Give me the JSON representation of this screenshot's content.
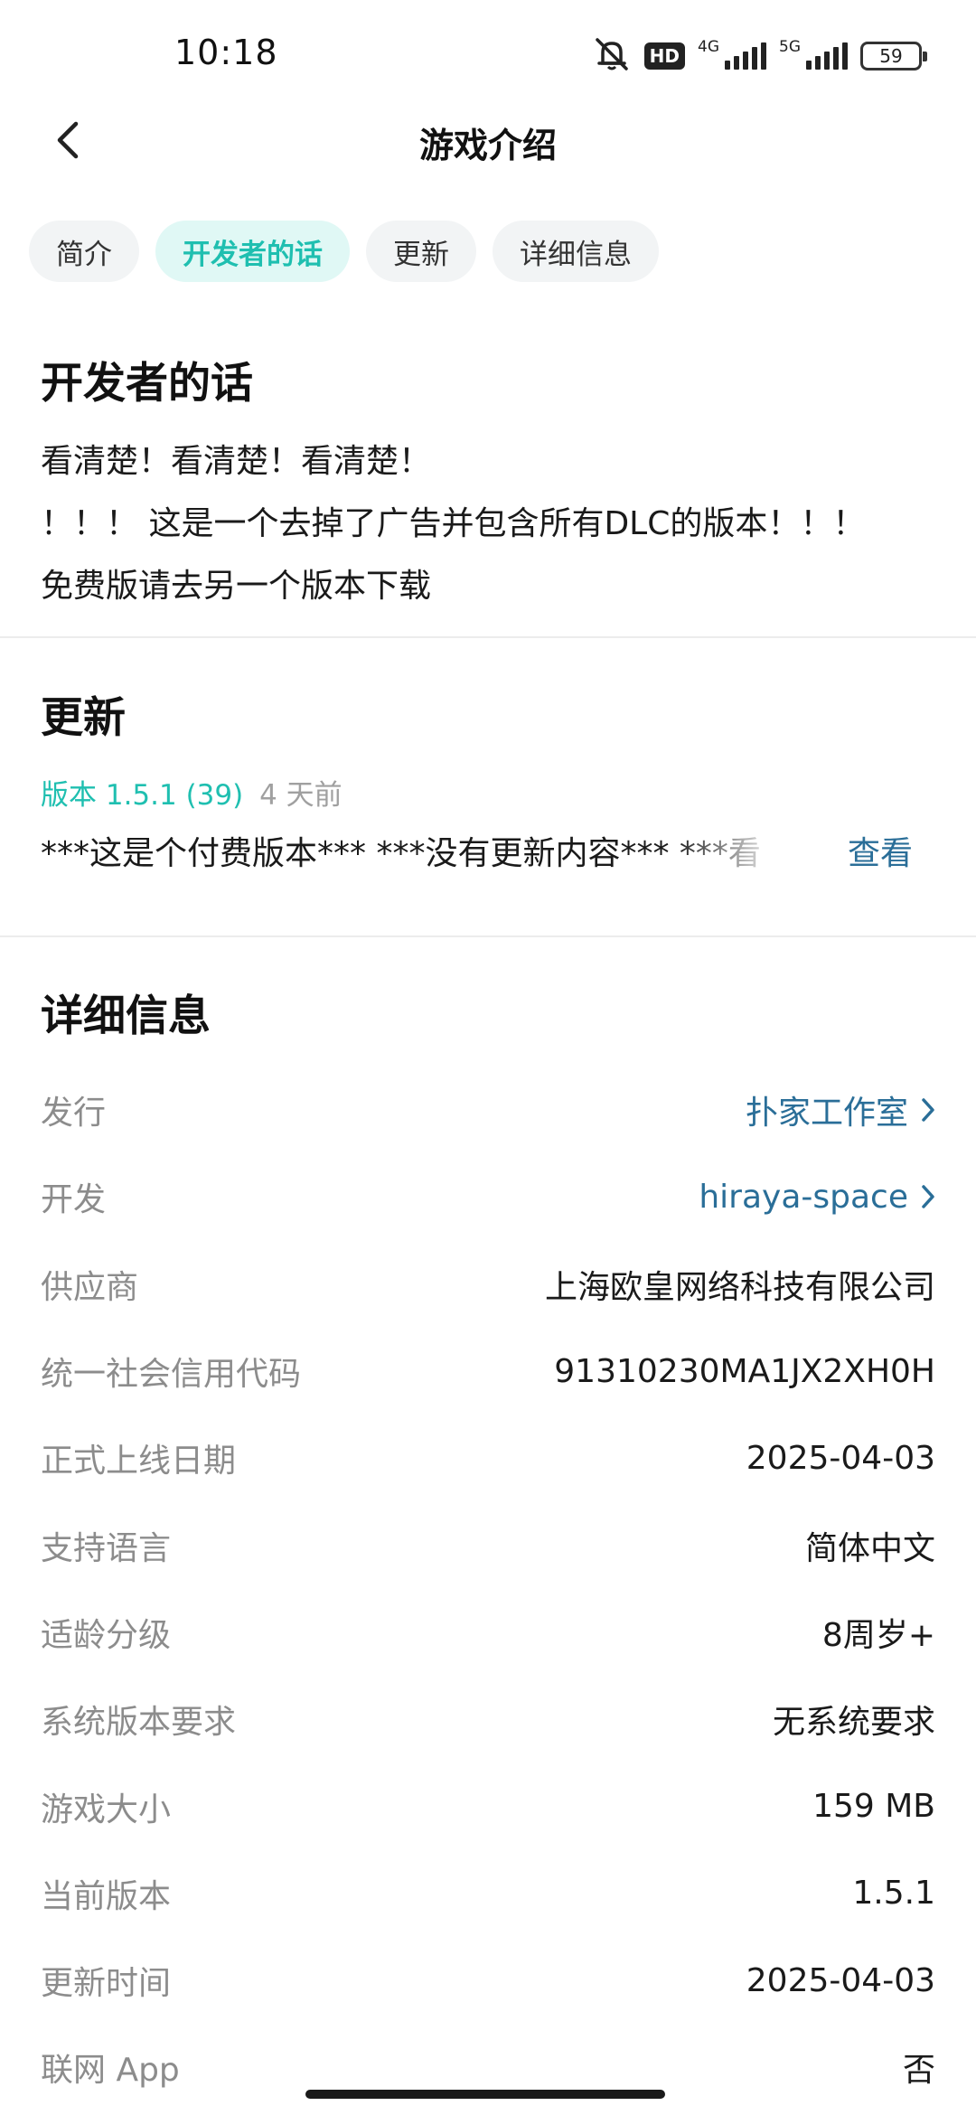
{
  "status_bar": {
    "time": "10:18",
    "hd_badge": "HD",
    "network_1": "4G",
    "network_2": "5G",
    "battery": "59"
  },
  "header": {
    "title": "游戏介绍"
  },
  "tabs": [
    {
      "label": "简介",
      "active": false
    },
    {
      "label": "开发者的话",
      "active": true
    },
    {
      "label": "更新",
      "active": false
    },
    {
      "label": "详细信息",
      "active": false
    }
  ],
  "developer_notes": {
    "title": "开发者的话",
    "lines": [
      "看清楚！看清楚！看清楚！",
      "！！！ 这是一个去掉了广告并包含所有DLC的版本！！！",
      "免费版请去另一个版本下载"
    ]
  },
  "update": {
    "title": "更新",
    "version": "版本 1.5.1 (39)",
    "ago": "4 天前",
    "summary": "***这是个付费版本*** ***没有更新内容*** ***看",
    "view_label": "查看"
  },
  "details": {
    "title": "详细信息",
    "rows": [
      {
        "label": "发行",
        "value": "扑家工作室",
        "link": true
      },
      {
        "label": "开发",
        "value": "hiraya-space",
        "link": true
      },
      {
        "label": "供应商",
        "value": "上海欧皇网络科技有限公司",
        "link": false
      },
      {
        "label": "统一社会信用代码",
        "value": "91310230MA1JX2XH0H",
        "link": false
      },
      {
        "label": "正式上线日期",
        "value": "2025-04-03",
        "link": false
      },
      {
        "label": "支持语言",
        "value": "简体中文",
        "link": false
      },
      {
        "label": "适龄分级",
        "value": "8周岁+",
        "link": false
      },
      {
        "label": "系统版本要求",
        "value": "无系统要求",
        "link": false
      },
      {
        "label": "游戏大小",
        "value": "159 MB",
        "link": false
      },
      {
        "label": "当前版本",
        "value": "1.5.1",
        "link": false
      },
      {
        "label": "更新时间",
        "value": "2025-04-03",
        "link": false
      },
      {
        "label": "联网 App",
        "value": "否",
        "link": false
      }
    ]
  },
  "colors": {
    "accent": "#1fbfb0",
    "link": "#2a6e98",
    "muted": "#8c8c8c"
  }
}
